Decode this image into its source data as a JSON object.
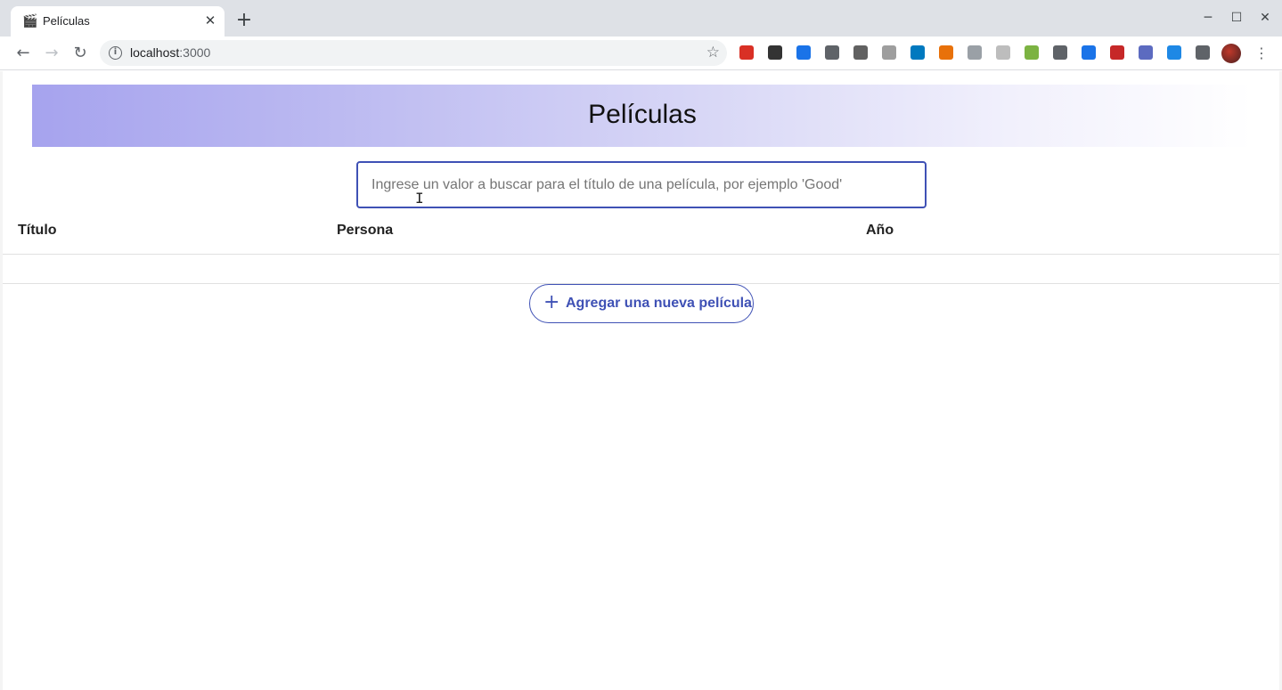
{
  "browser": {
    "tab_title": "Películas",
    "tab_favicon": "🎬",
    "url_host": "localhost",
    "url_port": ":3000",
    "extensions": [
      {
        "name": "ext-red-icon",
        "color": "#d93025"
      },
      {
        "name": "ext-flow-icon",
        "color": "#333333"
      },
      {
        "name": "ext-blue-hex-icon",
        "color": "#1a73e8"
      },
      {
        "name": "ext-grid-icon",
        "color": "#5f6368"
      },
      {
        "name": "ext-c-icon",
        "color": "#616161"
      },
      {
        "name": "ext-te-icon",
        "color": "#9e9e9e"
      },
      {
        "name": "ext-trello-icon",
        "color": "#0079bf"
      },
      {
        "name": "ext-orange-icon",
        "color": "#e8710a"
      },
      {
        "name": "ext-gray-icon",
        "color": "#9aa0a6"
      },
      {
        "name": "ext-clock-icon",
        "color": "#bdbdbd"
      },
      {
        "name": "ext-sheet-icon",
        "color": "#7cb342"
      },
      {
        "name": "ext-vue-icon",
        "color": "#5f6368"
      },
      {
        "name": "ext-calendar-icon",
        "color": "#1a73e8"
      },
      {
        "name": "ext-red-play-icon",
        "color": "#c62828"
      },
      {
        "name": "ext-gear-icon",
        "color": "#5c6bc0"
      },
      {
        "name": "ext-appstore-icon",
        "color": "#1e88e5"
      },
      {
        "name": "ext-puzzle-icon",
        "color": "#5f6368"
      }
    ]
  },
  "page": {
    "title": "Películas",
    "search_placeholder": "Ingrese un valor a buscar para el título de una película, por ejemplo 'Good'",
    "columns": [
      "Título",
      "Persona",
      "Año"
    ],
    "add_button_label": "Agregar una nueva película",
    "accent_color": "#3f51b5"
  }
}
